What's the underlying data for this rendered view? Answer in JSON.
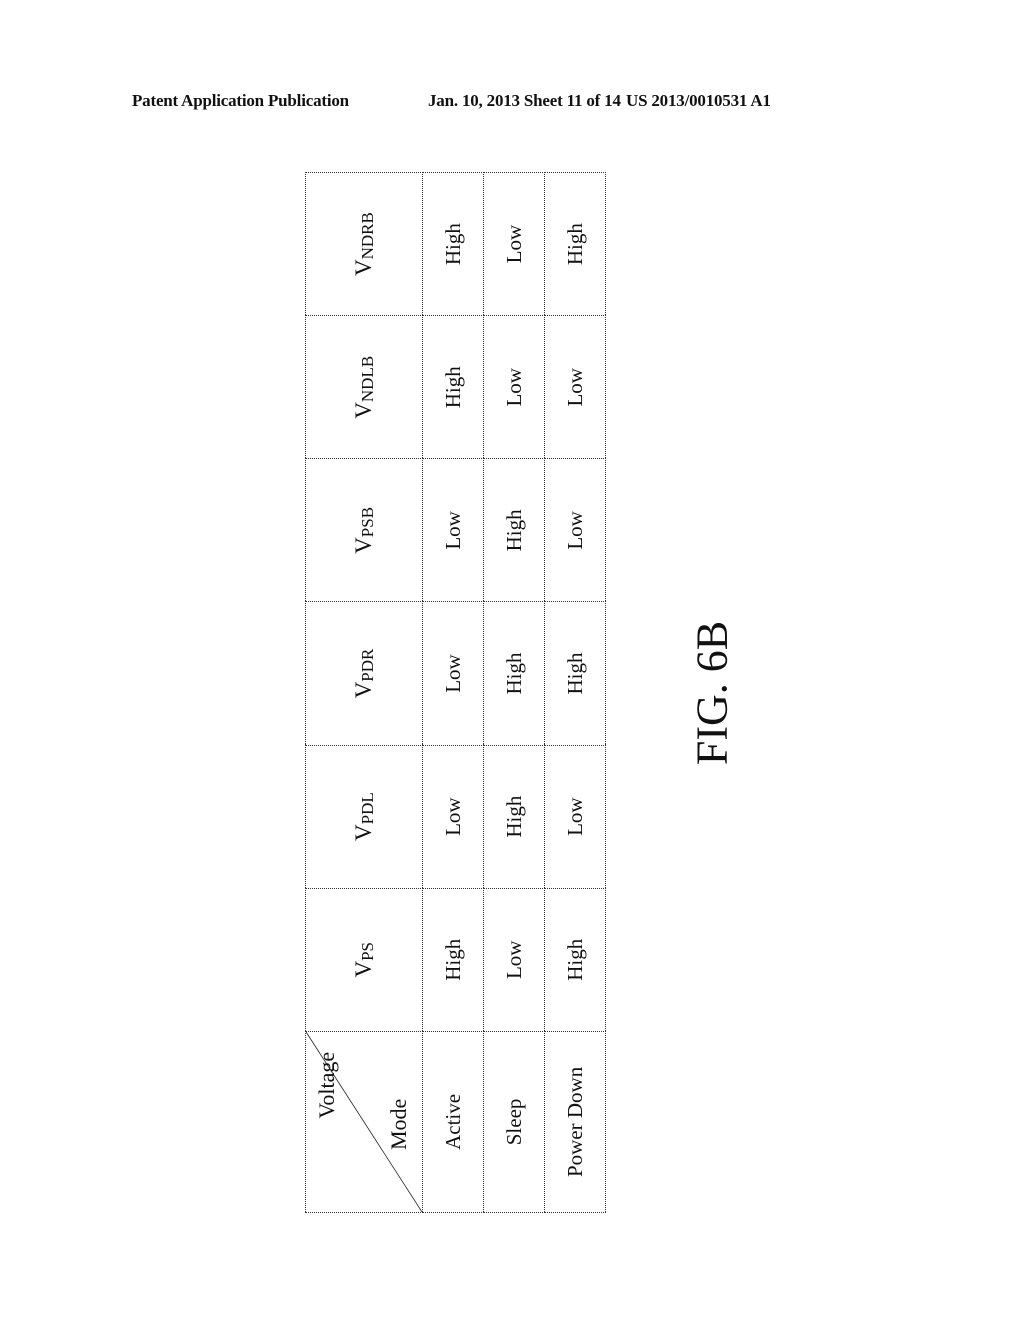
{
  "header": {
    "left": "Patent Application Publication",
    "middle": "Jan. 10, 2013   Sheet 11 of 14",
    "right": "US 2013/0010531 A1"
  },
  "table": {
    "corner": {
      "top_right": "Voltage",
      "bottom_left": "Mode"
    },
    "columns": [
      {
        "main": "V",
        "sub": "PS"
      },
      {
        "main": "V",
        "sub": "PDL"
      },
      {
        "main": "V",
        "sub": "PDR"
      },
      {
        "main": "V",
        "sub": "PSB"
      },
      {
        "main": "V",
        "sub": "NDLB"
      },
      {
        "main": "V",
        "sub": "NDRB"
      }
    ],
    "rows": [
      {
        "mode": "Active",
        "values": [
          "High",
          "Low",
          "Low",
          "Low",
          "High",
          "High"
        ]
      },
      {
        "mode": "Sleep",
        "values": [
          "Low",
          "High",
          "High",
          "High",
          "Low",
          "Low"
        ]
      },
      {
        "mode": "Power Down",
        "values": [
          "High",
          "Low",
          "High",
          "Low",
          "Low",
          "High"
        ]
      }
    ]
  },
  "figure_label": "FIG. 6B"
}
